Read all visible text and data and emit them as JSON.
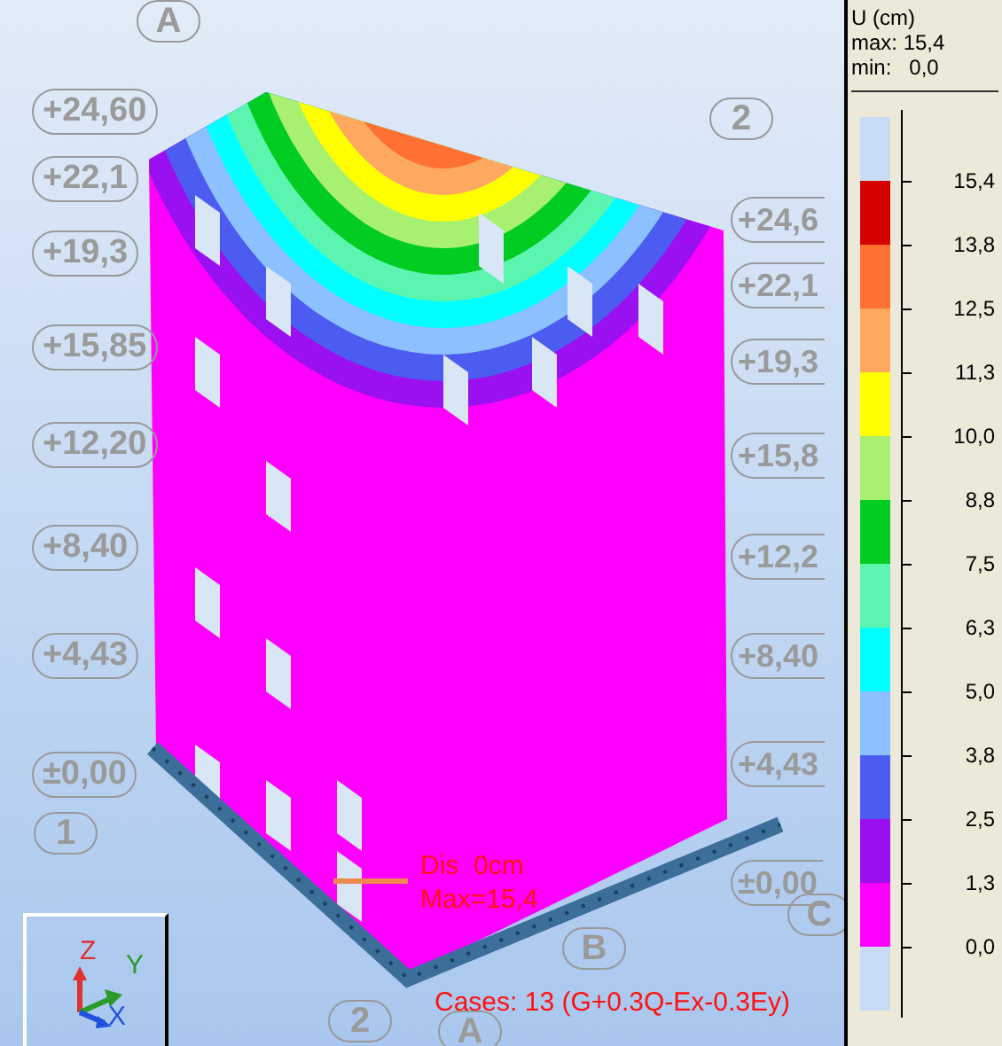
{
  "viewport": {
    "elevations_left": [
      "+24,60",
      "+22,1",
      "+19,3",
      "+15,85",
      "+12,20",
      "+8,40",
      "+4,43",
      "±0,00"
    ],
    "elevations_right": [
      "+24,6",
      "+22,1",
      "+19,3",
      "+15,8",
      "+12,2",
      "+8,40",
      "+4,43",
      "±0,00"
    ],
    "grid_axes": [
      "A",
      "2",
      "1",
      "C",
      "B",
      "2",
      "A"
    ],
    "annotations": [
      "Dis  0cm",
      "Max=15,4",
      "Cases: 13 (G+0.3Q-Ex-0.3Ey)"
    ],
    "axis_labels": [
      "Z",
      "Y",
      "X"
    ]
  },
  "legend": {
    "title": "U (cm)",
    "max": "max: 15,4",
    "min": "min:   0,0",
    "bands": [
      {
        "color": "#d50000",
        "label": "15,4"
      },
      {
        "color": "#ff7033",
        "label": "13,8"
      },
      {
        "color": "#ffa860",
        "label": "12,5"
      },
      {
        "color": "#ffff00",
        "label": "11,3"
      },
      {
        "color": "#a8f070",
        "label": "10,0"
      },
      {
        "color": "#00cc22",
        "label": "8,8"
      },
      {
        "color": "#5cf5b0",
        "label": "7,5"
      },
      {
        "color": "#00ffff",
        "label": "6,3"
      },
      {
        "color": "#8cc0ff",
        "label": "5,0"
      },
      {
        "color": "#4c5cf0",
        "label": "3,8"
      },
      {
        "color": "#9a10f0",
        "label": "2,5"
      },
      {
        "color": "#ff00ff",
        "label": "1,3"
      },
      {
        "color": "#c8dcf5",
        "label": "0,0"
      }
    ]
  }
}
